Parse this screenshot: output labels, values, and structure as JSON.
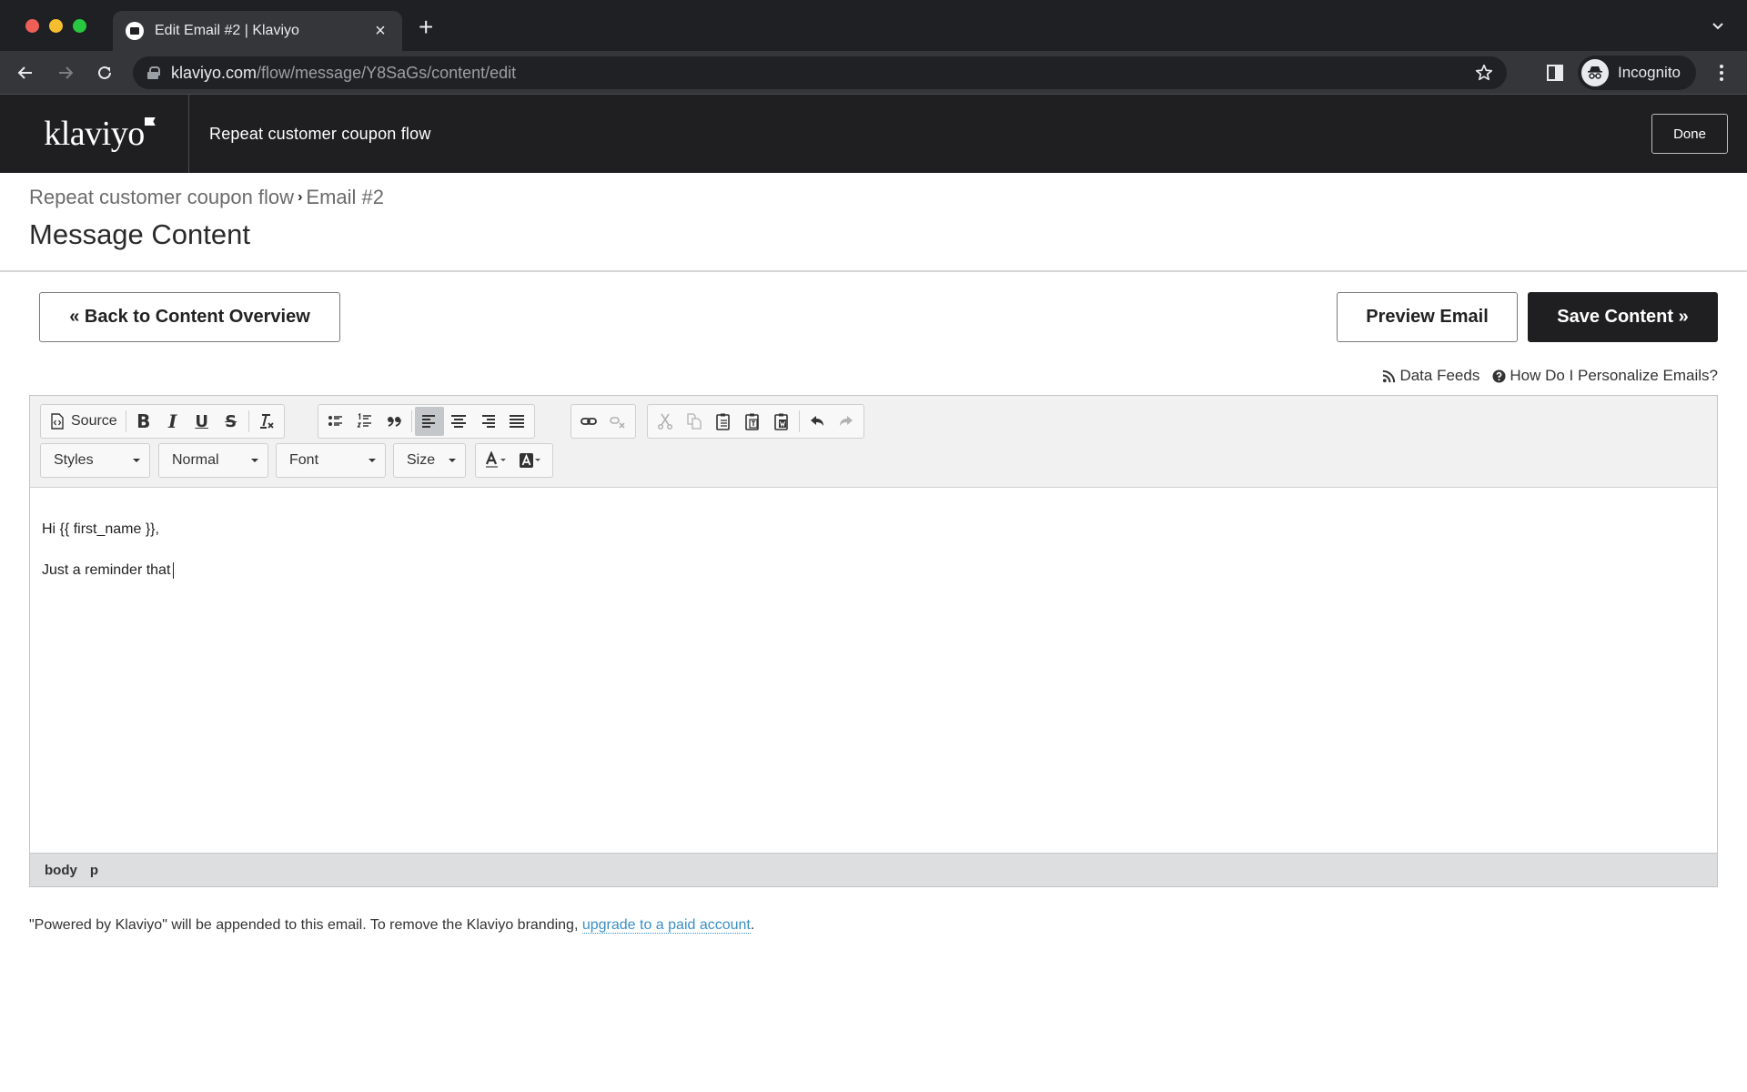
{
  "browser": {
    "tab_title": "Edit Email #2 | Klaviyo",
    "url_host": "klaviyo.com",
    "url_path": "/flow/message/Y8SaGs/content/edit",
    "profile_label": "Incognito"
  },
  "app": {
    "logo_text": "klaviyo",
    "flow_title": "Repeat customer coupon flow",
    "done_label": "Done"
  },
  "page": {
    "breadcrumb": [
      "Repeat customer coupon flow",
      "Email #2"
    ],
    "title": "Message Content"
  },
  "actions": {
    "back_label": "« Back to Content Overview",
    "preview_label": "Preview Email",
    "save_label": "Save Content »"
  },
  "help": {
    "data_feeds": "Data Feeds",
    "personalize": "How Do I Personalize Emails?"
  },
  "editor": {
    "source_label": "Source",
    "combos": {
      "styles": "Styles",
      "format": "Normal",
      "font": "Font",
      "size": "Size"
    },
    "content": [
      "Hi {{ first_name }},",
      "Just a reminder that"
    ],
    "element_path": [
      "body",
      "p"
    ]
  },
  "footer": {
    "text": "\"Powered by Klaviyo\" will be appended to this email. To remove the Klaviyo branding, ",
    "link": "upgrade to a paid account",
    "suffix": "."
  },
  "colors": {
    "brand_dark": "#1f1f21",
    "link": "#3a8fc7"
  }
}
